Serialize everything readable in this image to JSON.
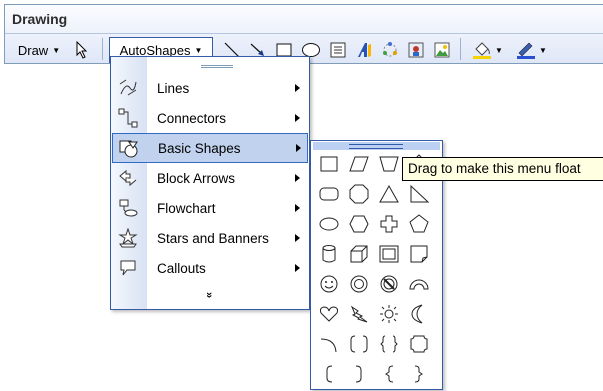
{
  "toolbar": {
    "title": "Drawing",
    "draw_label": "Draw",
    "autoshapes_label": "AutoShapes",
    "tools": [
      "select-objects-icon",
      "line-icon",
      "arrow-icon",
      "rectangle-icon",
      "oval-icon",
      "text-box-icon",
      "wordart-icon",
      "diagram-icon",
      "clip-art-icon",
      "picture-icon",
      "fill-color-icon",
      "line-color-icon"
    ]
  },
  "autoshapes_menu": {
    "items": [
      {
        "label": "Lines",
        "icon": "lines-icon"
      },
      {
        "label": "Connectors",
        "icon": "connectors-icon"
      },
      {
        "label": "Basic Shapes",
        "icon": "basic-shapes-icon",
        "highlighted": true
      },
      {
        "label": "Block Arrows",
        "icon": "block-arrows-icon"
      },
      {
        "label": "Flowchart",
        "icon": "flowchart-icon"
      },
      {
        "label": "Stars and Banners",
        "icon": "stars-banners-icon"
      },
      {
        "label": "Callouts",
        "icon": "callouts-icon"
      }
    ],
    "more": "»"
  },
  "basic_shapes": [
    "rectangle",
    "parallelogram",
    "trapezoid",
    "diamond",
    "rounded-rectangle",
    "octagon",
    "isosceles-triangle",
    "right-triangle",
    "oval",
    "hexagon",
    "cross",
    "pentagon",
    "can",
    "cube",
    "bevel",
    "folded-corner",
    "smiley-face",
    "donut",
    "no-symbol",
    "block-arc",
    "heart",
    "lightning-bolt",
    "sun",
    "moon",
    "arc",
    "double-bracket",
    "double-brace",
    "plaque",
    "left-bracket",
    "right-bracket",
    "left-brace",
    "right-brace"
  ],
  "tooltip": {
    "text": "Drag to make this menu float"
  },
  "colors": {
    "accent": "#316ac5",
    "highlight": "#c1d2ee",
    "toolbar_bg": "#dfe7f7",
    "tooltip_bg": "#ffffe1"
  }
}
